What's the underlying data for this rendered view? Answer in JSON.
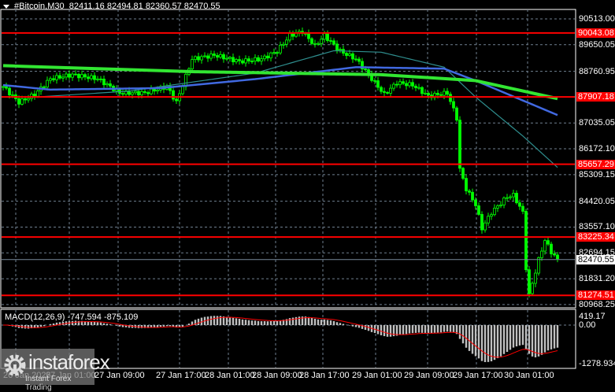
{
  "header": {
    "symbol": "#Bitcoin,M30",
    "open": "82411.16",
    "high": "82494.81",
    "low": "82360.57",
    "close": "82470.55"
  },
  "price_axis": [
    "90513.00",
    "89650.05",
    "88760.95",
    "87035.05",
    "86172.10",
    "85309.15",
    "84420.05",
    "83557.10",
    "82694.15",
    "81831.20",
    "80968.25"
  ],
  "levels": [
    {
      "label": "90043.08",
      "value": 90043.08
    },
    {
      "label": "87907.18",
      "value": 87907.18
    },
    {
      "label": "85657.29",
      "value": 85657.29
    },
    {
      "label": "83225.34",
      "value": 83225.34
    },
    {
      "label": "81274.51",
      "value": 81274.51
    }
  ],
  "current_price": {
    "label": "82470.55",
    "value": 82470.55
  },
  "macd": {
    "label": "MACD(12,26,9) -747.594 -875.109",
    "axis": [
      "419.17",
      "0.00",
      "-1278.934"
    ]
  },
  "time_axis": [
    "26 Jan 2026",
    "27 Jan 01:00",
    "27 Jan 09:00",
    "27 Jan 17:00",
    "28 Jan 01:00",
    "28 Jan 09:00",
    "28 Jan 17:00",
    "29 Jan 01:00",
    "29 Jan 09:00",
    "29 Jan 17:00",
    "30 Jan 01:00"
  ],
  "watermark": {
    "brand": "instaforex",
    "tagline": "Instant Forex Trading"
  },
  "colors": {
    "candle": "#00ff00",
    "level": "#ff0000",
    "ma_slow": "#32e632",
    "ma_mid": "#4169e1",
    "ma_fast": "#2f8f8f",
    "macd_hist": "#c0c0c0",
    "macd_signal": "#ff0000",
    "grid": "#708090"
  },
  "chart_data": {
    "type": "candlestick",
    "title": "#Bitcoin,M30",
    "close_path": [
      [
        0,
        88251
      ],
      [
        5,
        87725
      ],
      [
        10,
        87988
      ],
      [
        15,
        88514
      ],
      [
        22,
        88646
      ],
      [
        30,
        88514
      ],
      [
        37,
        88041
      ],
      [
        45,
        88041
      ],
      [
        52,
        88251
      ],
      [
        55,
        87725
      ],
      [
        60,
        89172
      ],
      [
        67,
        89303
      ],
      [
        75,
        89093
      ],
      [
        82,
        89172
      ],
      [
        87,
        89435
      ],
      [
        91,
        89961
      ],
      [
        95,
        90092
      ],
      [
        99,
        89619
      ],
      [
        102,
        89961
      ],
      [
        107,
        89435
      ],
      [
        112,
        89172
      ],
      [
        117,
        88514
      ],
      [
        121,
        87988
      ],
      [
        125,
        88383
      ],
      [
        130,
        88304
      ],
      [
        135,
        87936
      ],
      [
        141,
        88041
      ],
      [
        144,
        87199
      ],
      [
        145,
        85490
      ],
      [
        147,
        84832
      ],
      [
        150,
        84306
      ],
      [
        152,
        83517
      ],
      [
        155,
        84043
      ],
      [
        160,
        84569
      ],
      [
        162,
        84622
      ],
      [
        165,
        84043
      ],
      [
        166,
        82202
      ],
      [
        167,
        81282
      ],
      [
        170,
        82465
      ],
      [
        172,
        83123
      ],
      [
        174,
        82728
      ],
      [
        176,
        82470
      ]
    ],
    "ma_slow": [
      [
        0,
        88950
      ],
      [
        60,
        88750
      ],
      [
        120,
        88650
      ],
      [
        150,
        88450
      ],
      [
        176,
        87850
      ]
    ],
    "ma_mid": [
      [
        0,
        88300
      ],
      [
        15,
        88150
      ],
      [
        50,
        88200
      ],
      [
        80,
        88500
      ],
      [
        112,
        88900
      ],
      [
        140,
        88850
      ],
      [
        150,
        88450
      ],
      [
        176,
        87300
      ]
    ],
    "ma_fast": [
      [
        10,
        87900
      ],
      [
        40,
        88100
      ],
      [
        80,
        88700
      ],
      [
        105,
        89450
      ],
      [
        120,
        89400
      ],
      [
        140,
        88900
      ],
      [
        150,
        87900
      ],
      [
        165,
        86600
      ],
      [
        176,
        85550
      ]
    ],
    "ylim": [
      80968.25,
      90513.0
    ]
  }
}
